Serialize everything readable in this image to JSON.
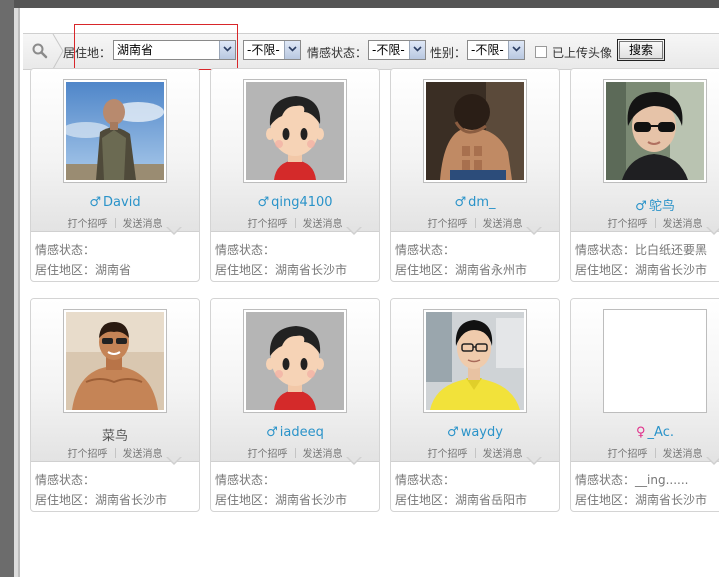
{
  "filters": {
    "residence_label": "居住地：",
    "residence_value": "湖南省",
    "residence_district_value": "-不限-",
    "relationship_label": "情感状态：",
    "relationship_value": "-不限-",
    "gender_label": "性别：",
    "gender_value": "-不限-",
    "avatar_only_label": "已上传头像",
    "avatar_only_checked": false,
    "search_button": "搜索"
  },
  "card_labels": {
    "greet": "打个招呼",
    "message": "发送消息",
    "relationship": "情感状态：",
    "residence": "居住地区："
  },
  "users": [
    {
      "name": "David",
      "gender": "male",
      "gender_icon": "♂",
      "relationship": "",
      "residence": "湖南省",
      "avatar": "photo-man-outdoor"
    },
    {
      "name": "qing4100",
      "gender": "male",
      "gender_icon": "♂",
      "relationship": "",
      "residence": "湖南省长沙市",
      "avatar": "default-cartoon-avatar"
    },
    {
      "name": "dm_",
      "gender": "male",
      "gender_icon": "♂",
      "relationship": "",
      "residence": "湖南省永州市",
      "avatar": "photo-shirtless-man"
    },
    {
      "name": "鸵鸟",
      "gender": "male",
      "gender_icon": "♂",
      "relationship": "比白纸还要黑",
      "residence": "湖南省长沙市",
      "avatar": "photo-sunglasses-man"
    },
    {
      "name": "菜鸟",
      "gender": "",
      "gender_icon": "",
      "relationship": "",
      "residence": "湖南省长沙市",
      "avatar": "photo-shirtless-man-beach"
    },
    {
      "name": "iadeeq",
      "gender": "male",
      "gender_icon": "♂",
      "relationship": "",
      "residence": "湖南省长沙市",
      "avatar": "default-cartoon-avatar"
    },
    {
      "name": "waydy",
      "gender": "male",
      "gender_icon": "♂",
      "relationship": "",
      "residence": "湖南省岳阳市",
      "avatar": "photo-man-glasses-yellow-shirt"
    },
    {
      "name": "_Ac.",
      "gender": "female",
      "gender_icon": "♀",
      "relationship": "__ing......",
      "residence": "湖南省长沙市",
      "avatar": "blank-avatar"
    }
  ],
  "colors": {
    "username": "#2a93c9",
    "female": "#e0308a",
    "highlight_box": "#d8262a"
  }
}
